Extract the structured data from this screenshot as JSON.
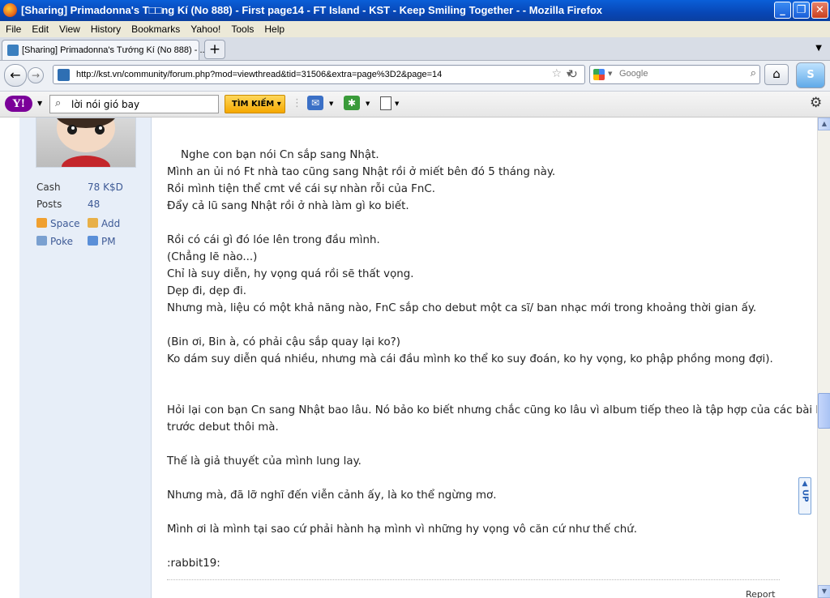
{
  "window": {
    "title": "[Sharing] Primadonna's T□□ng Kí (No 888) - First page14 - FT Island - KST - Keep Smiling Together - - Mozilla Firefox",
    "minimize": "_",
    "maximize": "❐",
    "close": "✕"
  },
  "menu": [
    "File",
    "Edit",
    "View",
    "History",
    "Bookmarks",
    "Yahoo!",
    "Tools",
    "Help"
  ],
  "tab": {
    "title": "[Sharing] Primadonna's Tướng Kí (No 888) - ...",
    "new_tab": "+"
  },
  "nav": {
    "url": "http://kst.vn/community/forum.php?mod=viewthread&tid=31506&extra=page%3D2&page=14",
    "search_placeholder": "Google"
  },
  "yahoo": {
    "logo": "Y!",
    "query": "lời nói gió bay",
    "button": "TÌM KIẾM"
  },
  "profile": {
    "stats": [
      {
        "label": "Cash",
        "value": "78 K$D"
      },
      {
        "label": "Posts",
        "value": "48"
      }
    ],
    "actions": [
      "Space",
      "Add",
      "Poke",
      "PM"
    ]
  },
  "post": {
    "lines": [
      "    Nghe con bạn nói Cn sắp sang Nhật.",
      "Mình an ủi nó Ft nhà tao cũng sang Nhật rồi ở miết bên đó 5 tháng này.",
      "Rồi mình tiện thể cmt về cái sự nhàn rỗi của FnC.",
      "Đẩy cả lũ sang Nhật rồi ở nhà làm gì ko biết.",
      "",
      "Rồi có cái gì đó lóe lên trong đầu mình.",
      "(Chẳng lẽ nào...)",
      "Chỉ là suy diễn, hy vọng quá rồi sẽ thất vọng.",
      "Dẹp đi, dẹp đi.",
      "Nhưng mà, liệu có một khả năng nào, FnC sắp cho debut một ca sĩ/ ban nhạc mới trong khoảng thời gian ấy.",
      "",
      "(Bin ơi, Bin à, có phải cậu sắp quay lại ko?)",
      "Ko dám suy diễn quá nhiều, nhưng mà cái đầu mình ko thể ko suy đoán, ko hy vọng, ko phập phồng mong đợi).",
      "",
      "",
      "Hỏi lại con bạn Cn sang Nhật bao lâu. Nó bảo ko biết nhưng chắc cũng ko lâu vì album tiếp theo là tập hợp của các bài hát",
      "trước debut thôi mà.",
      "",
      "Thế là giả thuyết của mình lung lay.",
      "",
      "Nhưng mà, đã lỡ nghĩ đến viễn cảnh ấy, là ko thể ngừng mơ.",
      "",
      "Mình ơi là mình tại sao cứ phải hành hạ mình vì những hy vọng vô căn cứ như thế chứ.",
      "",
      ":rabbit19:"
    ],
    "report": "Report",
    "up_label": "UP"
  }
}
